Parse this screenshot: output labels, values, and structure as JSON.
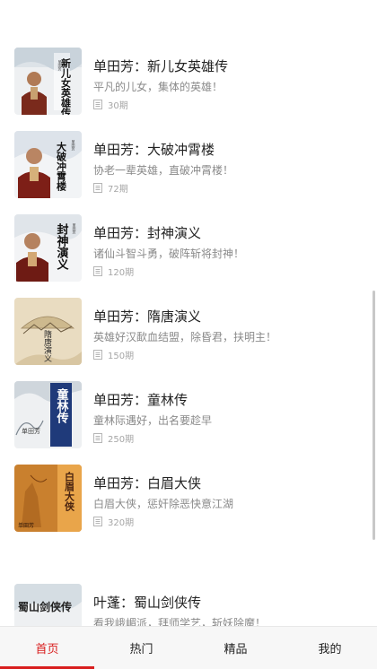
{
  "list": {
    "items": [
      {
        "title": "单田芳：新儿女英雄传",
        "desc": "平凡的儿女，集体的英雄！",
        "count": "30期",
        "cover": "cover-xin-er-nv-ying-xiong-zhuan"
      },
      {
        "title": "单田芳：大破冲霄楼",
        "desc": "协老一辈英雄，直破冲霄楼！",
        "count": "72期",
        "cover": "cover-da-po-chong-xiao-lou"
      },
      {
        "title": "单田芳：封神演义",
        "desc": "诸仙斗智斗勇，破阵斩将封神！",
        "count": "120期",
        "cover": "cover-feng-shen-yan-yi"
      },
      {
        "title": "单田芳：隋唐演义",
        "desc": "英雄好汉歃血结盟，除昏君，扶明主！",
        "count": "150期",
        "cover": "cover-sui-tang-yan-yi"
      },
      {
        "title": "单田芳：童林传",
        "desc": "童林际遇好，出名要趁早",
        "count": "250期",
        "cover": "cover-tong-lin-zhuan"
      },
      {
        "title": "单田芳：白眉大侠",
        "desc": "白眉大侠，惩奸除恶快意江湖",
        "count": "320期",
        "cover": "cover-bai-mei-da-xia"
      },
      {
        "title": "叶蓬：蜀山剑侠传",
        "desc": "看我峨嵋派，拜师学艺，斩妖除魔！",
        "count": "",
        "cover": "cover-shu-shan-jian-xia-zhuan"
      }
    ]
  },
  "covers": {
    "c1": {
      "text": "新儿女英雄传",
      "tag": "单田芳"
    },
    "c2": {
      "text": "大破冲霄楼",
      "tag": "单田芳"
    },
    "c3": {
      "text": "封神演义",
      "tag": "单田芳"
    },
    "c4": {
      "text": "隋唐演义"
    },
    "c5": {
      "text": "童林传",
      "tag": "单田芳"
    },
    "c6": {
      "text": "白眉大侠",
      "tag": "单田芳"
    },
    "c7": {
      "text": "蜀山剑侠传"
    }
  },
  "tabbar": {
    "tabs": [
      {
        "label": "首页",
        "active": true
      },
      {
        "label": "热门",
        "active": false
      },
      {
        "label": "精品",
        "active": false
      },
      {
        "label": "我的",
        "active": false
      }
    ]
  },
  "colors": {
    "accent": "#d81e1e",
    "title": "#222222",
    "desc": "#8a8a8a",
    "count": "#a6a6a6",
    "tabbar_bg": "#f7f7f7"
  },
  "icons": {
    "episode_count": "list-icon"
  }
}
